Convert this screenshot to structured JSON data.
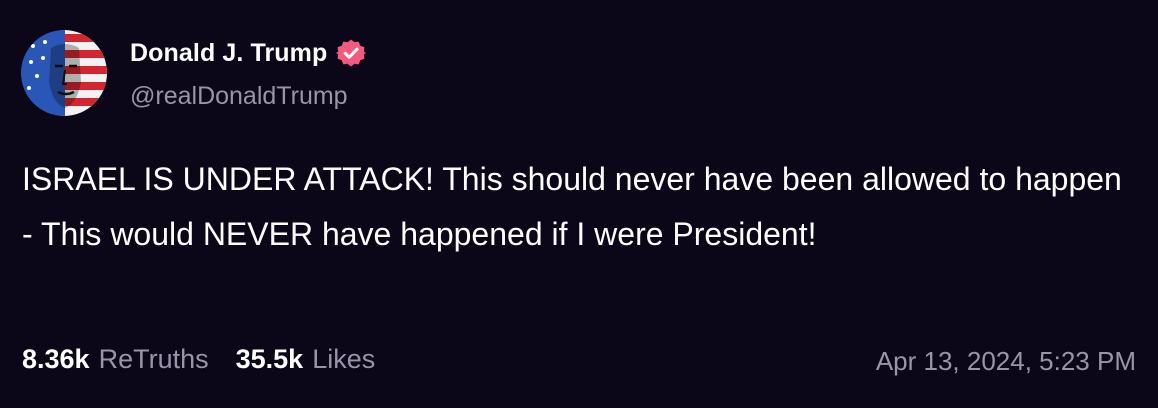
{
  "post": {
    "author": {
      "name": "Donald J. Trump",
      "handle": "@realDonaldTrump",
      "verified": true,
      "avatar_icon": "flag-face-avatar-icon"
    },
    "text": "ISRAEL IS UNDER ATTACK! This should never have been allowed to happen - This would NEVER have happened if I were President!",
    "stats": {
      "retruths_count": "8.36k",
      "retruths_label": "ReTruths",
      "likes_count": "35.5k",
      "likes_label": "Likes"
    },
    "timestamp": "Apr 13, 2024, 5:23 PM"
  },
  "colors": {
    "background": "#0b0719",
    "text": "#ffffff",
    "muted": "#9994a8",
    "verified_badge": "#f45a7e"
  }
}
